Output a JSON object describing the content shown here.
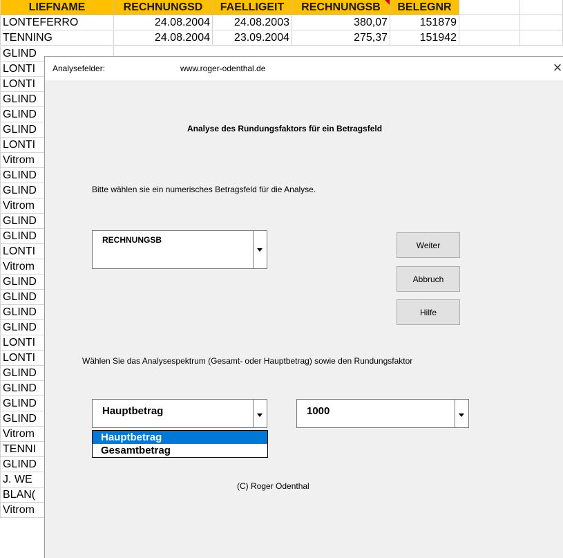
{
  "sheet": {
    "headers": [
      "LIEFNAME",
      "RECHNUNGSD",
      "FAELLIGEIT",
      "RECHNUNGSB",
      "BELEGNR",
      "",
      ""
    ],
    "rows": [
      [
        "LONTEFERRO",
        "24.08.2004",
        "24.08.2003",
        "380,07",
        "151879"
      ],
      [
        "TENNING",
        "24.08.2004",
        "23.09.2004",
        "275,37",
        "151942"
      ]
    ],
    "column_a_fragments": [
      "GLIND",
      "LONTI",
      "LONTI",
      "GLIND",
      "GLIND",
      "GLIND",
      "LONTI",
      "Vitrom",
      "GLIND",
      "GLIND",
      "Vitrom",
      "GLIND",
      "GLIND",
      "LONTI",
      "Vitrom",
      "GLIND",
      "GLIND",
      "GLIND",
      "GLIND",
      "LONTI",
      "LONTI",
      "GLIND",
      "GLIND",
      "GLIND",
      "GLIND",
      "Vitrom",
      "TENNI",
      "GLIND",
      "J. WE",
      "BLAN(",
      "Vitrom"
    ]
  },
  "dialog": {
    "title": "Analysefelder:",
    "url": "www.roger-odenthal.de",
    "close_symbol": "×",
    "heading": "Analyse des Rundungsfaktors für ein Betragsfeld",
    "instruction_1": "Bitte wählen sie ein numerisches Betragsfeld für die Analyse.",
    "field_select": {
      "value": "RECHNUNGSB"
    },
    "buttons": {
      "next": "Weiter",
      "cancel": "Abbruch",
      "help": "Hilfe"
    },
    "instruction_2": "Wählen Sie das Analysespektrum (Gesamt- oder Hauptbetrag) sowie den Rundungsfaktor",
    "spectrum_select": {
      "value": "Hauptbetrag",
      "options": [
        "Hauptbetrag",
        "Gesamtbetrag"
      ]
    },
    "factor_select": {
      "value": "1000"
    },
    "footer": "(C) Roger Odenthal"
  },
  "colors": {
    "header_fill": "#ffc000",
    "dialog_bg": "#f0f0f0",
    "selection": "#0078d7"
  }
}
